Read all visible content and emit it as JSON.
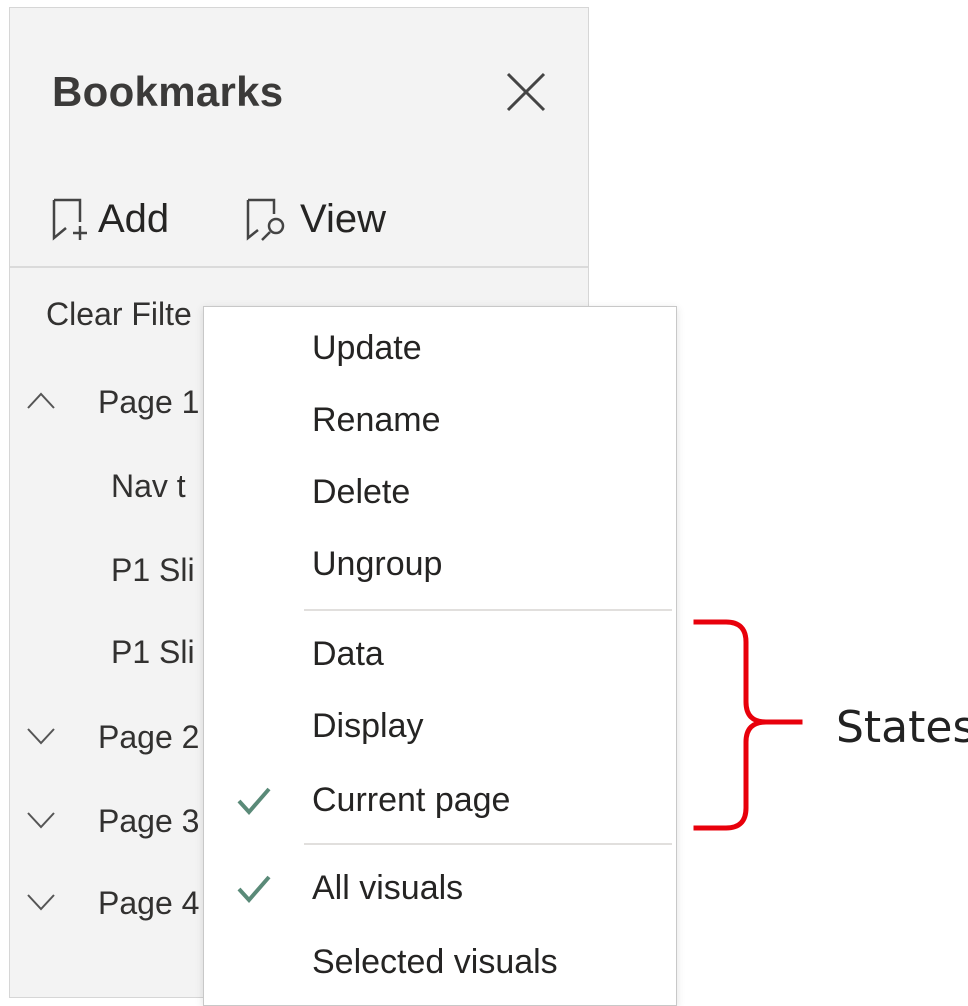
{
  "pane": {
    "title": "Bookmarks",
    "add_label": "Add",
    "view_label": "View",
    "rows": [
      {
        "text": "Clear Filte",
        "type": "bookmark"
      },
      {
        "text": "Page 1",
        "type": "group",
        "expanded": true
      },
      {
        "text": "Nav t",
        "type": "child"
      },
      {
        "text": "P1 Sli",
        "type": "child"
      },
      {
        "text": "P1 Sli",
        "type": "child"
      },
      {
        "text": "Page 2",
        "type": "group",
        "expanded": false
      },
      {
        "text": "Page 3",
        "type": "group",
        "expanded": false
      },
      {
        "text": "Page 4",
        "type": "group",
        "expanded": false
      }
    ]
  },
  "menu": {
    "items": [
      {
        "label": "Update",
        "checked": false
      },
      {
        "label": "Rename",
        "checked": false
      },
      {
        "label": "Delete",
        "checked": false
      },
      {
        "label": "Ungroup",
        "checked": false
      },
      {
        "label": "Data",
        "checked": false
      },
      {
        "label": "Display",
        "checked": false
      },
      {
        "label": "Current page",
        "checked": true
      },
      {
        "label": "All visuals",
        "checked": true
      },
      {
        "label": "Selected visuals",
        "checked": false
      }
    ]
  },
  "annotation": {
    "label": "States",
    "color": "#e8000b"
  },
  "colors": {
    "check": "#5a8a78",
    "pane_bg": "#f3f3f3"
  }
}
